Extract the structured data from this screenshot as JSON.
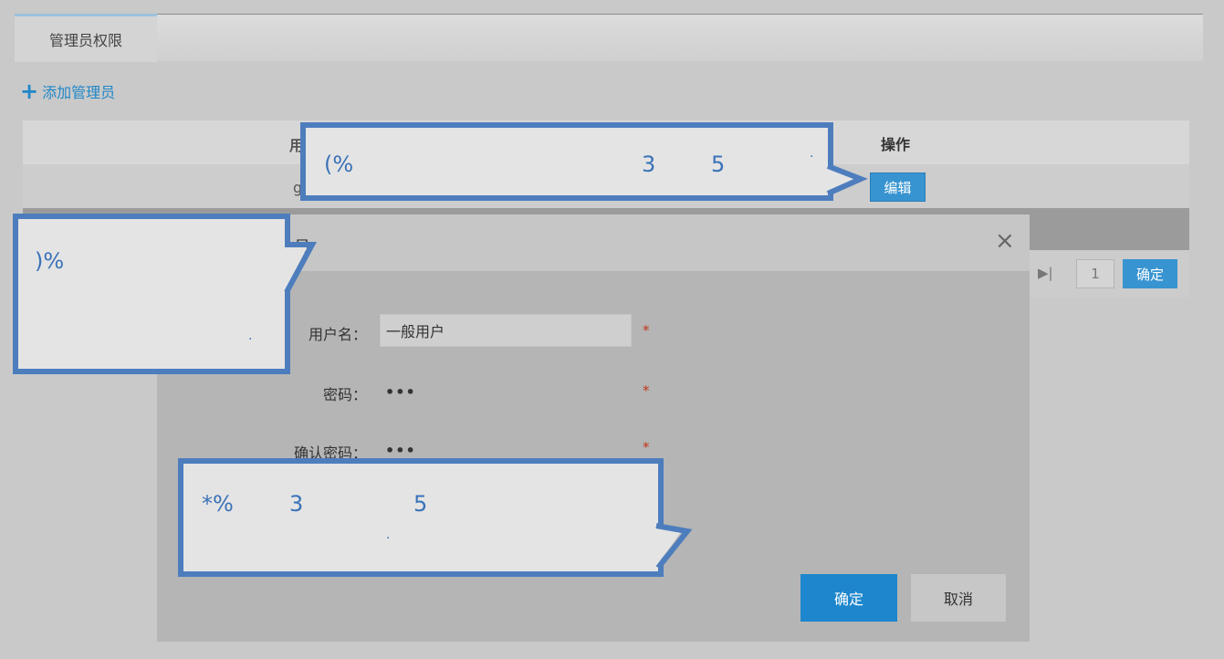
{
  "tabs": {
    "active_label": "管理员权限"
  },
  "toolbar": {
    "add_admin_label": "添加管理员",
    "add_icon": "+"
  },
  "table": {
    "header_user_partial": "用",
    "header_operation": "操作",
    "row_user_partial": "g",
    "edit_label": "编辑"
  },
  "pagination": {
    "last_icon": "▶|",
    "page_value": "1",
    "go_label": "确定"
  },
  "dialog": {
    "title_partial": "员",
    "close_icon": "×",
    "username_label": "用户名：",
    "username_value": "一般用户",
    "password_label": "密码：",
    "password_value": "•••",
    "confirm_password_label": "确认密码：",
    "confirm_password_value": "•••",
    "required_mark": "*",
    "ok_label": "确定",
    "cancel_label": "取消"
  },
  "callouts": {
    "c1": {
      "text_a": "(%",
      "text_b": "3",
      "text_c": "5",
      "dot": "."
    },
    "c2": {
      "text_a": ")%",
      "dot": "."
    },
    "c3": {
      "text_a": "*%",
      "text_b": "3",
      "text_c": "5",
      "dot": "."
    }
  },
  "colors": {
    "accent": "#1d86cc",
    "callout_border": "#4d7dbd",
    "required": "#c0391b"
  }
}
